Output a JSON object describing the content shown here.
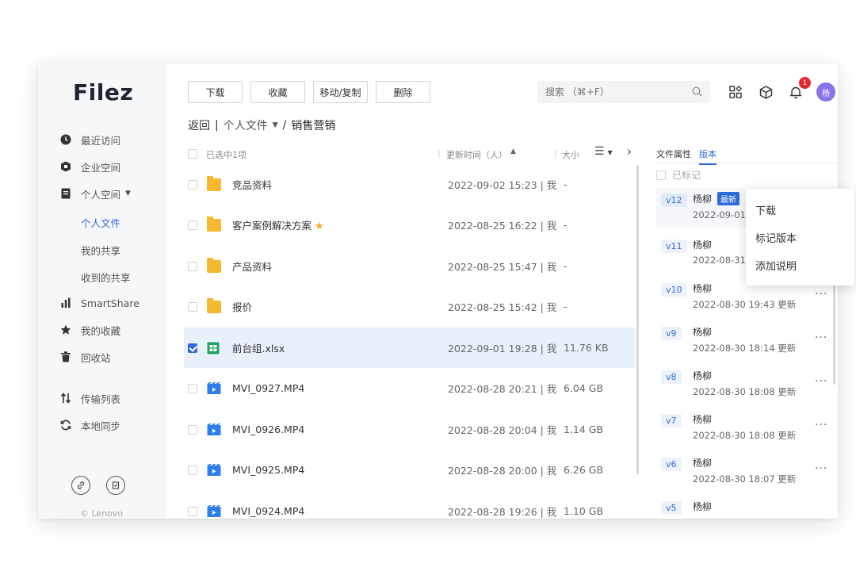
{
  "app": {
    "logo": "Filez",
    "copyright": "© Lenovo"
  },
  "sidebar": {
    "items": [
      {
        "label": "最近访问",
        "icon": "clock-icon"
      },
      {
        "label": "企业空间",
        "icon": "building-icon"
      },
      {
        "label": "个人空间",
        "icon": "document-icon"
      },
      {
        "label": "SmartShare",
        "icon": "bar-chart-icon"
      },
      {
        "label": "我的收藏",
        "icon": "star-icon"
      },
      {
        "label": "回收站",
        "icon": "trash-icon"
      },
      {
        "label": "传输列表",
        "icon": "transfer-icon"
      },
      {
        "label": "本地同步",
        "icon": "sync-icon"
      }
    ],
    "sub_items": [
      "个人文件",
      "我的共享",
      "收到的共享"
    ]
  },
  "toolbar": {
    "download": "下载",
    "favorite": "收藏",
    "move_copy": "移动/复制",
    "delete": "删除"
  },
  "search": {
    "placeholder": "搜索 （⌘+F）"
  },
  "notifications": {
    "count": "1"
  },
  "user": {
    "avatar_text": "杨"
  },
  "breadcrumb": {
    "back": "返回",
    "sep": "|",
    "parent": "个人文件",
    "slash": "/",
    "current": "销售营销"
  },
  "list": {
    "selected_text": "已选中1项",
    "col_time": "更新时间（人）",
    "col_size": "大小",
    "rows": [
      {
        "name": "竞品资料",
        "type": "folder",
        "time": "2022-09-02 15:23 | 我",
        "size": "-"
      },
      {
        "name": "客户案例解决方案",
        "type": "folder",
        "time": "2022-08-25 16:22 | 我",
        "size": "-",
        "starred": true
      },
      {
        "name": "产品资料",
        "type": "folder",
        "time": "2022-08-25 15:47 | 我",
        "size": "-"
      },
      {
        "name": "报价",
        "type": "folder",
        "time": "2022-08-25 15:42 | 我",
        "size": "-"
      },
      {
        "name": "前台组.xlsx",
        "type": "xlsx",
        "time": "2022-09-01 19:28 | 我",
        "size": "11.76 KB",
        "selected": true
      },
      {
        "name": "MVI_0927.MP4",
        "type": "video",
        "time": "2022-08-28 20:21 | 我",
        "size": "6.04 GB"
      },
      {
        "name": "MVI_0926.MP4",
        "type": "video",
        "time": "2022-08-28 20:04 | 我",
        "size": "1.14 GB"
      },
      {
        "name": "MVI_0925.MP4",
        "type": "video",
        "time": "2022-08-28 20:00 | 我",
        "size": "6.26 GB"
      },
      {
        "name": "MVI_0924.MP4",
        "type": "video",
        "time": "2022-08-28 19:26 | 我",
        "size": "1.10 GB"
      }
    ]
  },
  "panel": {
    "tab_properties": "文件属性",
    "tab_versions": "版本",
    "marked_label": "已标记",
    "latest_badge": "最新",
    "versions": [
      {
        "tag": "v12",
        "user": "杨柳",
        "time": "2022-09-01 1",
        "latest": true
      },
      {
        "tag": "v11",
        "user": "杨柳",
        "time": "2022-08-31 1"
      },
      {
        "tag": "v10",
        "user": "杨柳",
        "time": "2022-08-30 19:43 更新"
      },
      {
        "tag": "v9",
        "user": "杨柳",
        "time": "2022-08-30 18:14 更新"
      },
      {
        "tag": "v8",
        "user": "杨柳",
        "time": "2022-08-30 18:08 更新"
      },
      {
        "tag": "v7",
        "user": "杨柳",
        "time": "2022-08-30 18:08 更新"
      },
      {
        "tag": "v6",
        "user": "杨柳",
        "time": "2022-08-30 18:07 更新"
      },
      {
        "tag": "v5",
        "user": "杨柳",
        "time": ""
      }
    ]
  },
  "context_menu": {
    "items": [
      "下载",
      "标记版本",
      "添加说明"
    ]
  },
  "colors": {
    "accent": "#2f6bd8",
    "folder": "#f5b82e",
    "xlsx": "#1fa463",
    "video": "#2d7ff0",
    "badge": "#e5262c",
    "avatar": "#8a72e8"
  }
}
